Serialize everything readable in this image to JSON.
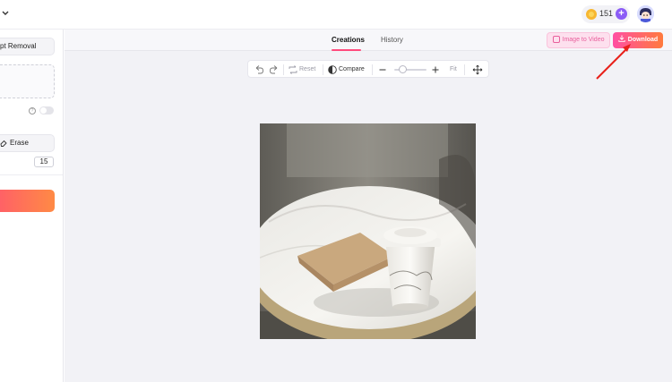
{
  "topbar": {
    "credits": "151"
  },
  "sidebar": {
    "mode_label": "pt Removal",
    "erase_label": "Erase",
    "brush_size": "15"
  },
  "tabs": {
    "creations": "Creations",
    "history": "History"
  },
  "actions": {
    "image_to_video": "Image to Video",
    "download": "Download"
  },
  "toolbar": {
    "reset": "Reset",
    "compare": "Compare",
    "fit": "Fit"
  },
  "colors": {
    "accent_pink": "#ff4b7d",
    "download_gradient_start": "#ff4fa3",
    "download_gradient_end": "#ff7a3d",
    "credits_add": "#8b5cf6",
    "annotation_arrow": "#e8201a"
  },
  "icons": [
    "chevron-down-icon",
    "coin-icon",
    "plus-icon",
    "avatar",
    "help-icon",
    "eraser-icon",
    "image-icon",
    "download-icon",
    "undo-icon",
    "redo-icon",
    "reset-icon",
    "compare-icon",
    "zoom-out-icon",
    "zoom-in-icon",
    "move-icon"
  ],
  "zoom_level_fraction": 0.25
}
